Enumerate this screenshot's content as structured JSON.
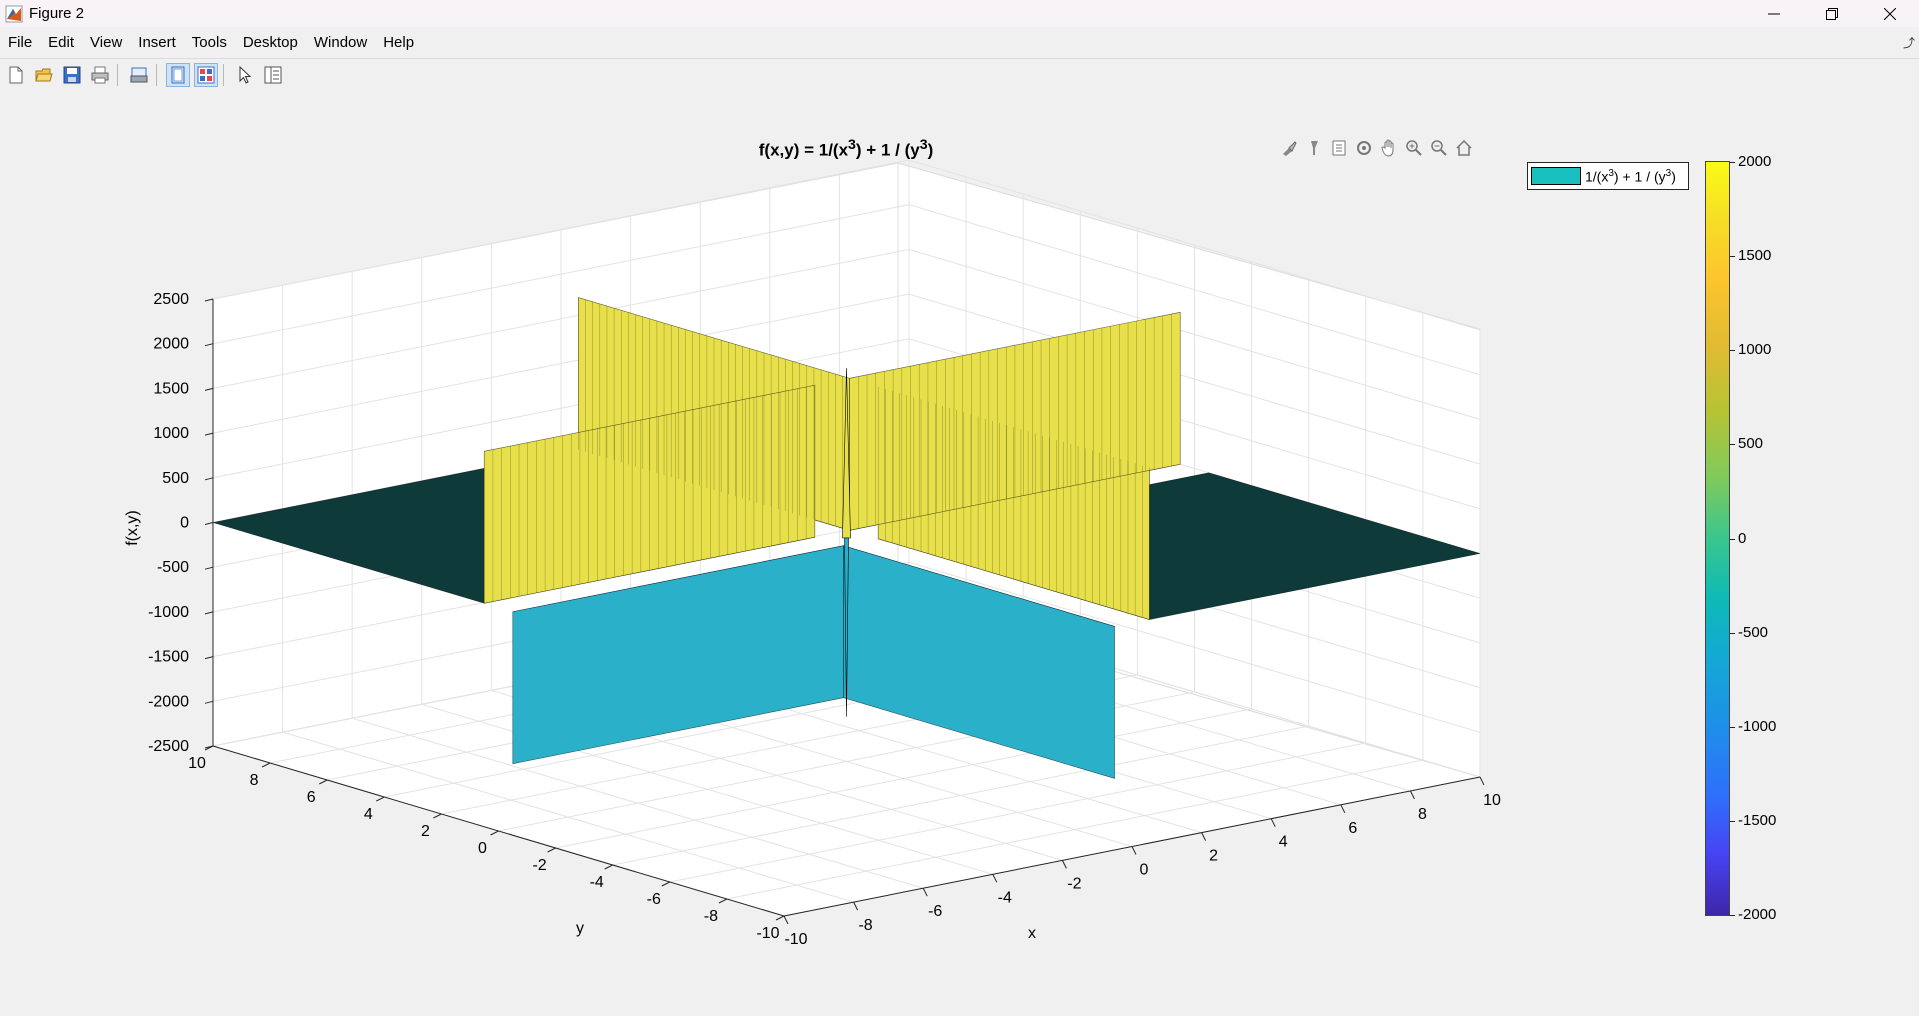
{
  "window": {
    "title": "Figure 2"
  },
  "menu": [
    "File",
    "Edit",
    "View",
    "Insert",
    "Tools",
    "Desktop",
    "Window",
    "Help"
  ],
  "toolbar": {
    "buttons": [
      "new-figure",
      "open-file",
      "save",
      "print",
      "print-preview",
      "dock-figure",
      "property-editor",
      "edit-plot",
      "insert-legend"
    ]
  },
  "axes_toolbar": [
    "brush",
    "data-tips",
    "export",
    "rotate-3d",
    "pan",
    "zoom-in",
    "zoom-out",
    "restore-view"
  ],
  "plot": {
    "title_main": "f(x,y) = 1/(x",
    "title_sup1": "3",
    "title_mid": ") + 1 / (y",
    "title_sup2": "3",
    "title_end": ")"
  },
  "legend": {
    "label_a": "1/(x",
    "sup_a": "3",
    "label_b": ") + 1 / (y",
    "sup_b": "3",
    "label_c": ")",
    "swatch_color": "#17bfbf"
  },
  "colorbar": {
    "ticks": [
      "2000",
      "1500",
      "1000",
      "500",
      "0",
      "-500",
      "-1000",
      "-1500",
      "-2000"
    ],
    "colormap": "parula",
    "range": [
      -2000,
      2000
    ]
  },
  "chart_data": {
    "type": "surface",
    "title": "f(x,y) = 1/(x^3) + 1 / (y^3)",
    "xlabel": "x",
    "ylabel": "y",
    "zlabel": "f(x,y)",
    "xlim": [
      -10,
      10
    ],
    "ylim": [
      -10,
      10
    ],
    "zlim": [
      -2500,
      2500
    ],
    "x_ticks": [
      "-10",
      "-8",
      "-6",
      "-4",
      "-2",
      "0",
      "2",
      "4",
      "6",
      "8",
      "10"
    ],
    "y_ticks": [
      "-10",
      "-8",
      "-6",
      "-4",
      "-2",
      "0",
      "2",
      "4",
      "6",
      "8",
      "10"
    ],
    "z_ticks": [
      "2500",
      "2000",
      "1500",
      "1000",
      "500",
      "0",
      "-500",
      "-1000",
      "-1500",
      "-2000",
      "-2500"
    ],
    "grid": true,
    "legend": "top-right",
    "series": [
      {
        "name": "1/(x^3) + 1 / (y^3)"
      }
    ],
    "colors": {
      "surface_flat": "#0e3a3a",
      "surface_high": "#e8e04a",
      "surface_low": "#2ab0c9"
    }
  }
}
